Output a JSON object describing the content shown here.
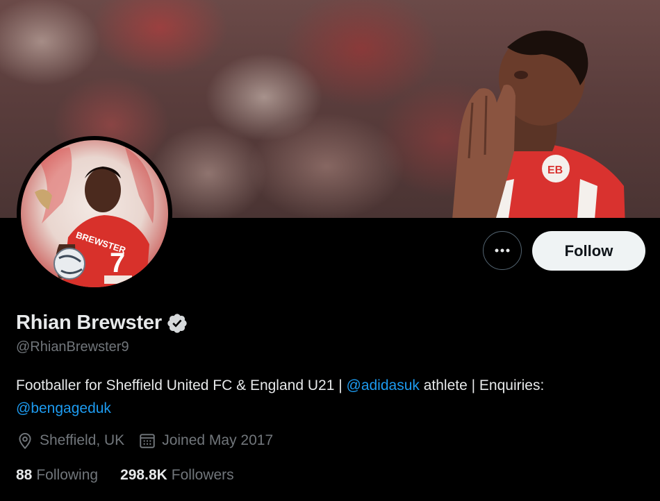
{
  "profile": {
    "name": "Rhian Brewster",
    "handle": "@RhianBrewster9",
    "verified": true,
    "bio_parts": {
      "text1": "Footballer for Sheffield United FC & England U21 | ",
      "mention1": "@adidasuk",
      "text2": " athlete | Enquiries:",
      "mention2": "@bengageduk"
    },
    "location": "Sheffield, UK",
    "joined": "Joined May 2017",
    "following_count": "88",
    "following_label": "Following",
    "followers_count": "298.8K",
    "followers_label": "Followers"
  },
  "actions": {
    "follow_label": "Follow",
    "avatar_shirt_text": "BREWSTER",
    "avatar_shirt_number": "7",
    "banner_shirt_badge": "EB"
  },
  "colors": {
    "background": "#000000",
    "accent": "#1d9bf0",
    "secondary_text": "#71767b",
    "primary_text": "#e7e9ea",
    "follow_button_bg": "#eff3f4"
  },
  "icons": {
    "more": "more-horizontal-icon",
    "verified": "verified-badge-icon",
    "location": "location-pin-icon",
    "calendar": "calendar-icon"
  }
}
